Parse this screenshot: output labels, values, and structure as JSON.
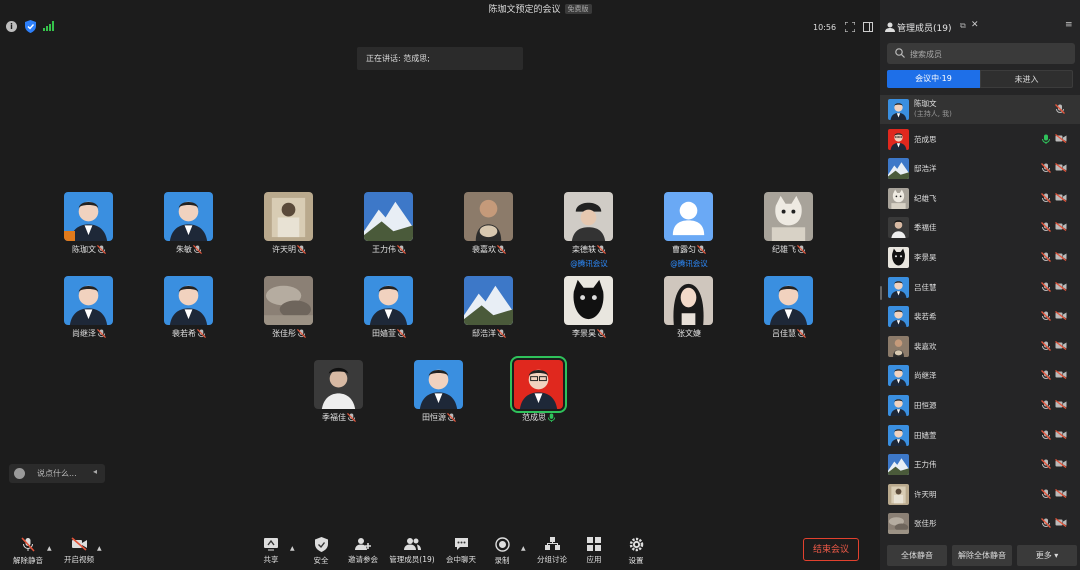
{
  "window": {
    "title": "陈珈文预定的会议",
    "badge": "免费版"
  },
  "status": {
    "time": "10:56"
  },
  "speaking": {
    "label": "正在讲话: 范成思;"
  },
  "tiles": [
    {
      "name": "陈珈文",
      "sub": "",
      "mic": "muted",
      "host": true,
      "avatar": "portrait-blue",
      "speaking": false
    },
    {
      "name": "朱敏",
      "sub": "",
      "mic": "muted",
      "host": false,
      "avatar": "portrait-blue",
      "speaking": false
    },
    {
      "name": "许天明",
      "sub": "",
      "mic": "muted",
      "host": false,
      "avatar": "photo-beige",
      "speaking": false
    },
    {
      "name": "王力伟",
      "sub": "",
      "mic": "muted",
      "host": false,
      "avatar": "mountain",
      "speaking": false
    },
    {
      "name": "裴嘉欢",
      "sub": "",
      "mic": "muted",
      "host": false,
      "avatar": "photo-dog",
      "speaking": false
    },
    {
      "name": "栾德轶",
      "sub": "@腾讯会议",
      "mic": "muted",
      "host": false,
      "avatar": "photo-cap",
      "speaking": false
    },
    {
      "name": "曹露匀",
      "sub": "@腾讯会议",
      "mic": "muted",
      "host": false,
      "avatar": "default-user",
      "speaking": false
    },
    {
      "name": "纪雄飞",
      "sub": "",
      "mic": "muted",
      "host": false,
      "avatar": "photo-cat",
      "speaking": false
    },
    {
      "name": "尚继泽",
      "sub": "",
      "mic": "muted",
      "host": false,
      "avatar": "portrait-blue",
      "speaking": false
    },
    {
      "name": "裴若希",
      "sub": "",
      "mic": "muted",
      "host": false,
      "avatar": "portrait-blue",
      "speaking": false
    },
    {
      "name": "张佳彤",
      "sub": "",
      "mic": "muted",
      "host": false,
      "avatar": "photo-blur",
      "speaking": false
    },
    {
      "name": "田嫱萱",
      "sub": "",
      "mic": "muted",
      "host": false,
      "avatar": "portrait-blue",
      "speaking": false
    },
    {
      "name": "邸浩洋",
      "sub": "",
      "mic": "muted",
      "host": false,
      "avatar": "mountain",
      "speaking": false
    },
    {
      "name": "李景昊",
      "sub": "",
      "mic": "muted",
      "host": false,
      "avatar": "photo-blackcat",
      "speaking": false
    },
    {
      "name": "张文婕",
      "sub": "",
      "mic": "none",
      "host": false,
      "avatar": "photo-girl",
      "speaking": false
    },
    {
      "name": "吕佳慧",
      "sub": "",
      "mic": "muted",
      "host": false,
      "avatar": "portrait-blue",
      "speaking": false
    },
    {
      "name": "季福佳",
      "sub": "",
      "mic": "muted",
      "host": false,
      "avatar": "photo-dark",
      "speaking": false
    },
    {
      "name": "田恒源",
      "sub": "",
      "mic": "muted",
      "host": false,
      "avatar": "portrait-blue",
      "speaking": false
    },
    {
      "name": "范成思",
      "sub": "",
      "mic": "on",
      "host": false,
      "avatar": "portrait-red",
      "speaking": true
    }
  ],
  "chat": {
    "placeholder": "说点什么..."
  },
  "toolbar": {
    "unmute": "解除静音",
    "video": "开启视频",
    "share": "共享",
    "security": "安全",
    "invite": "邀请参会",
    "members": "管理成员(19)",
    "chat": "会中聊天",
    "record": "录制",
    "breakout": "分组讨论",
    "apps": "应用",
    "settings": "设置",
    "end": "结束会议"
  },
  "panel": {
    "title": "管理成员(19)",
    "search_placeholder": "搜索成员",
    "tab_in": "会议中·19",
    "tab_out": "未进入",
    "members": [
      {
        "name": "陈珈文",
        "role": "(主持人, 我)",
        "mic": "muted",
        "cam": "none",
        "avatar": "portrait-blue"
      },
      {
        "name": "范成思",
        "role": "",
        "mic": "on",
        "cam": "off",
        "avatar": "portrait-red"
      },
      {
        "name": "邸浩洋",
        "role": "",
        "mic": "muted",
        "cam": "off",
        "avatar": "mountain"
      },
      {
        "name": "纪雄飞",
        "role": "",
        "mic": "muted",
        "cam": "off",
        "avatar": "photo-cat"
      },
      {
        "name": "季福佳",
        "role": "",
        "mic": "muted",
        "cam": "off",
        "avatar": "photo-dark"
      },
      {
        "name": "李景昊",
        "role": "",
        "mic": "muted",
        "cam": "off",
        "avatar": "photo-blackcat"
      },
      {
        "name": "吕佳慧",
        "role": "",
        "mic": "muted",
        "cam": "off",
        "avatar": "portrait-blue"
      },
      {
        "name": "裴若希",
        "role": "",
        "mic": "muted",
        "cam": "off",
        "avatar": "portrait-blue"
      },
      {
        "name": "裴嘉欢",
        "role": "",
        "mic": "muted",
        "cam": "off",
        "avatar": "photo-dog"
      },
      {
        "name": "尚继泽",
        "role": "",
        "mic": "muted",
        "cam": "off",
        "avatar": "portrait-blue"
      },
      {
        "name": "田恒源",
        "role": "",
        "mic": "muted",
        "cam": "off",
        "avatar": "portrait-blue"
      },
      {
        "name": "田嫱萱",
        "role": "",
        "mic": "muted",
        "cam": "off",
        "avatar": "portrait-blue"
      },
      {
        "name": "王力伟",
        "role": "",
        "mic": "muted",
        "cam": "off",
        "avatar": "mountain"
      },
      {
        "name": "许天明",
        "role": "",
        "mic": "muted",
        "cam": "off",
        "avatar": "photo-beige"
      },
      {
        "name": "张佳彤",
        "role": "",
        "mic": "muted",
        "cam": "off",
        "avatar": "photo-blur"
      }
    ],
    "btn_mute_all": "全体静音",
    "btn_unmute_all": "解除全体静音",
    "btn_more": "更多"
  },
  "colors": {
    "accent": "#1e6fe8",
    "speaking": "#2fc25b",
    "end": "#e2412e",
    "muted": "#e5553b",
    "link": "#2d8cff"
  }
}
